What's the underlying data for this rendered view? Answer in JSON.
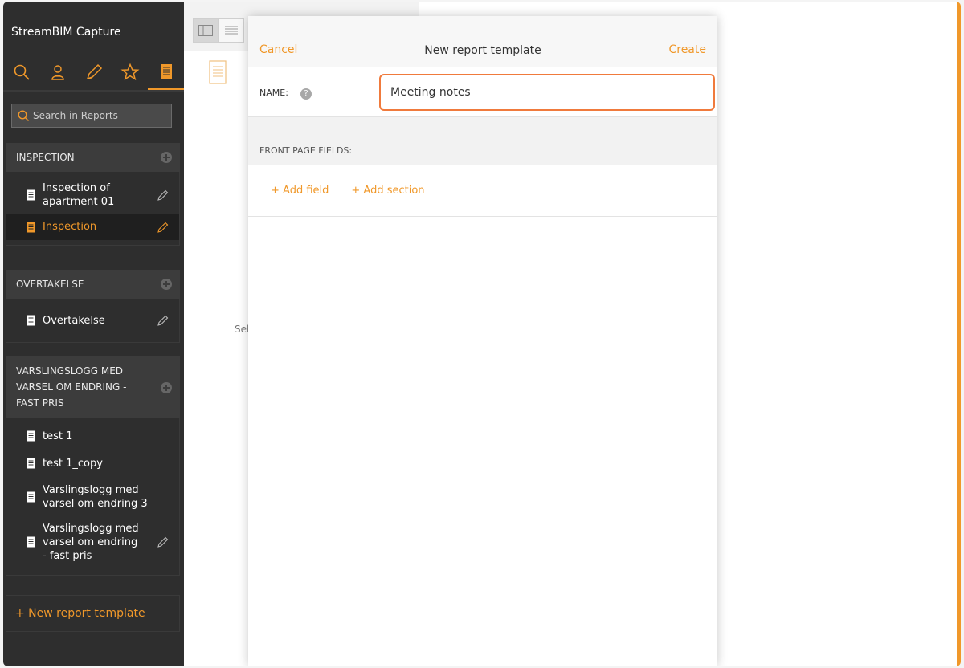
{
  "app": {
    "title": "StreamBIM Capture"
  },
  "nav": {
    "tabs": [
      {
        "icon": "search-icon"
      },
      {
        "icon": "user-icon"
      },
      {
        "icon": "pencil-icon"
      },
      {
        "icon": "star-icon"
      },
      {
        "icon": "report-icon",
        "active": true
      }
    ]
  },
  "search": {
    "placeholder": "Search in Reports"
  },
  "groups": [
    {
      "title": "INSPECTION",
      "items": [
        {
          "label": "Inspection of apartment 01",
          "editable": true
        },
        {
          "label": "Inspection",
          "editable": true,
          "active": true
        }
      ]
    },
    {
      "title": "OVERTAKELSE",
      "items": [
        {
          "label": "Overtakelse",
          "editable": true
        }
      ]
    },
    {
      "title": "VARSLINGSLOGG MED VARSEL OM ENDRING - FAST PRIS",
      "items": [
        {
          "label": "test 1",
          "editable": false
        },
        {
          "label": "test 1_copy",
          "editable": false
        },
        {
          "label": "Varslingslogg med varsel om endring 3",
          "editable": false
        },
        {
          "label": "Varslingslogg med varsel om endring - fast pris",
          "editable": true
        }
      ]
    }
  ],
  "new_template_label": "+ New report template",
  "middle": {
    "hint": "Sel"
  },
  "dialog": {
    "cancel": "Cancel",
    "title": "New report template",
    "create": "Create",
    "name_label": "NAME:",
    "help": "?",
    "name_value": "Meeting notes",
    "front_page_label": "FRONT PAGE FIELDS:",
    "add_field": "+ Add field",
    "add_section": "+ Add section"
  },
  "colors": {
    "accent": "#f0982a",
    "focus_border": "#f07a3c",
    "sidebar_bg": "#2e2e2e"
  }
}
